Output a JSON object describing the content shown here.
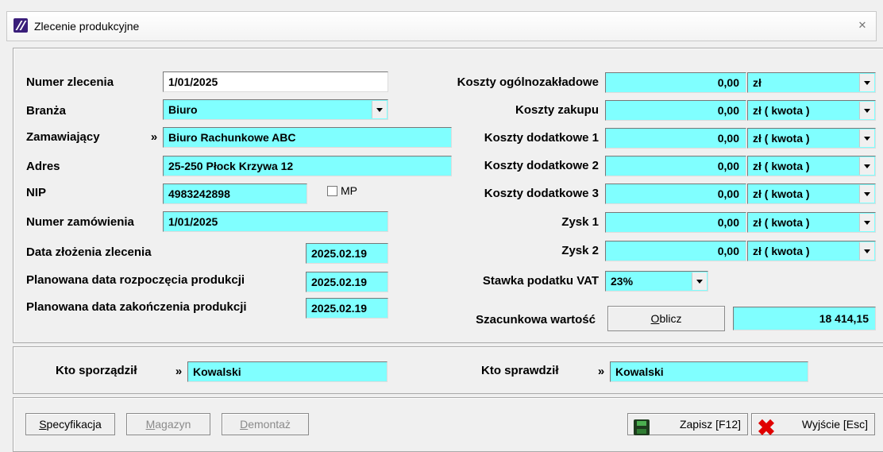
{
  "window": {
    "title": "Zlecenie produkcyjne",
    "close_glyph": "✕"
  },
  "left": {
    "numer_zlecenia": {
      "label": "Numer zlecenia",
      "value": "1/01/2025"
    },
    "branza": {
      "label": "Branża",
      "value": "Biuro"
    },
    "zamawiajacy": {
      "label": "Zamawiający",
      "picker": "»",
      "value": "Biuro Rachunkowe ABC"
    },
    "adres": {
      "label": "Adres",
      "value": "25-250 Płock Krzywa 12"
    },
    "nip": {
      "label": "NIP",
      "value": "4983242898",
      "mp_label": "MP",
      "mp_checked": false
    },
    "numer_zamowienia": {
      "label": "Numer zamówienia",
      "value": "1/01/2025"
    },
    "data_zlozenia": {
      "label": "Data złożenia zlecenia",
      "value": "2025.02.19"
    },
    "data_rozpoczecia": {
      "label": "Planowana data rozpoczęcia produkcji",
      "value": "2025.02.19"
    },
    "data_zakonczenia": {
      "label": "Planowana data zakończenia produkcji",
      "value": "2025.02.19"
    }
  },
  "right": {
    "koszty": [
      {
        "label": "Koszty ogólnozakładowe",
        "value": "0,00",
        "unit": "zł"
      },
      {
        "label": "Koszty zakupu",
        "value": "0,00",
        "unit": "zł ( kwota )"
      },
      {
        "label": "Koszty dodatkowe 1",
        "value": "0,00",
        "unit": "zł ( kwota )"
      },
      {
        "label": "Koszty dodatkowe 2",
        "value": "0,00",
        "unit": "zł ( kwota )"
      },
      {
        "label": "Koszty dodatkowe 3",
        "value": "0,00",
        "unit": "zł ( kwota )"
      },
      {
        "label": "Zysk 1",
        "value": "0,00",
        "unit": "zł ( kwota )"
      },
      {
        "label": "Zysk 2",
        "value": "0,00",
        "unit": "zł ( kwota )"
      }
    ],
    "vat": {
      "label": "Stawka podatku VAT",
      "value": "23%"
    },
    "szacunkowa": {
      "label": "Szacunkowa wartość",
      "button": "Oblicz",
      "button_hotkey": "O",
      "button_rest": "blicz",
      "value": "18 414,15"
    }
  },
  "people": {
    "sporzadzil": {
      "label": "Kto sporządził",
      "picker": "»",
      "value": "Kowalski"
    },
    "sprawdzil": {
      "label": "Kto sprawdził",
      "picker": "»",
      "value": "Kowalski"
    }
  },
  "footer": {
    "specyfikacja": {
      "hotkey": "S",
      "rest": "pecyfikacja",
      "enabled": true
    },
    "magazyn": {
      "hotkey": "M",
      "rest": "agazyn",
      "enabled": false
    },
    "demontaz": {
      "hotkey": "D",
      "rest": "emontaż",
      "enabled": false
    },
    "zapisz": {
      "label": "Zapisz  [F12]"
    },
    "wyjscie": {
      "label": "Wyjście  [Esc]"
    }
  },
  "icons": {
    "app": "app-logo-icon",
    "save": "floppy-disk-icon",
    "exit": "red-x-icon"
  },
  "colors": {
    "field_bg": "#80ffff"
  }
}
